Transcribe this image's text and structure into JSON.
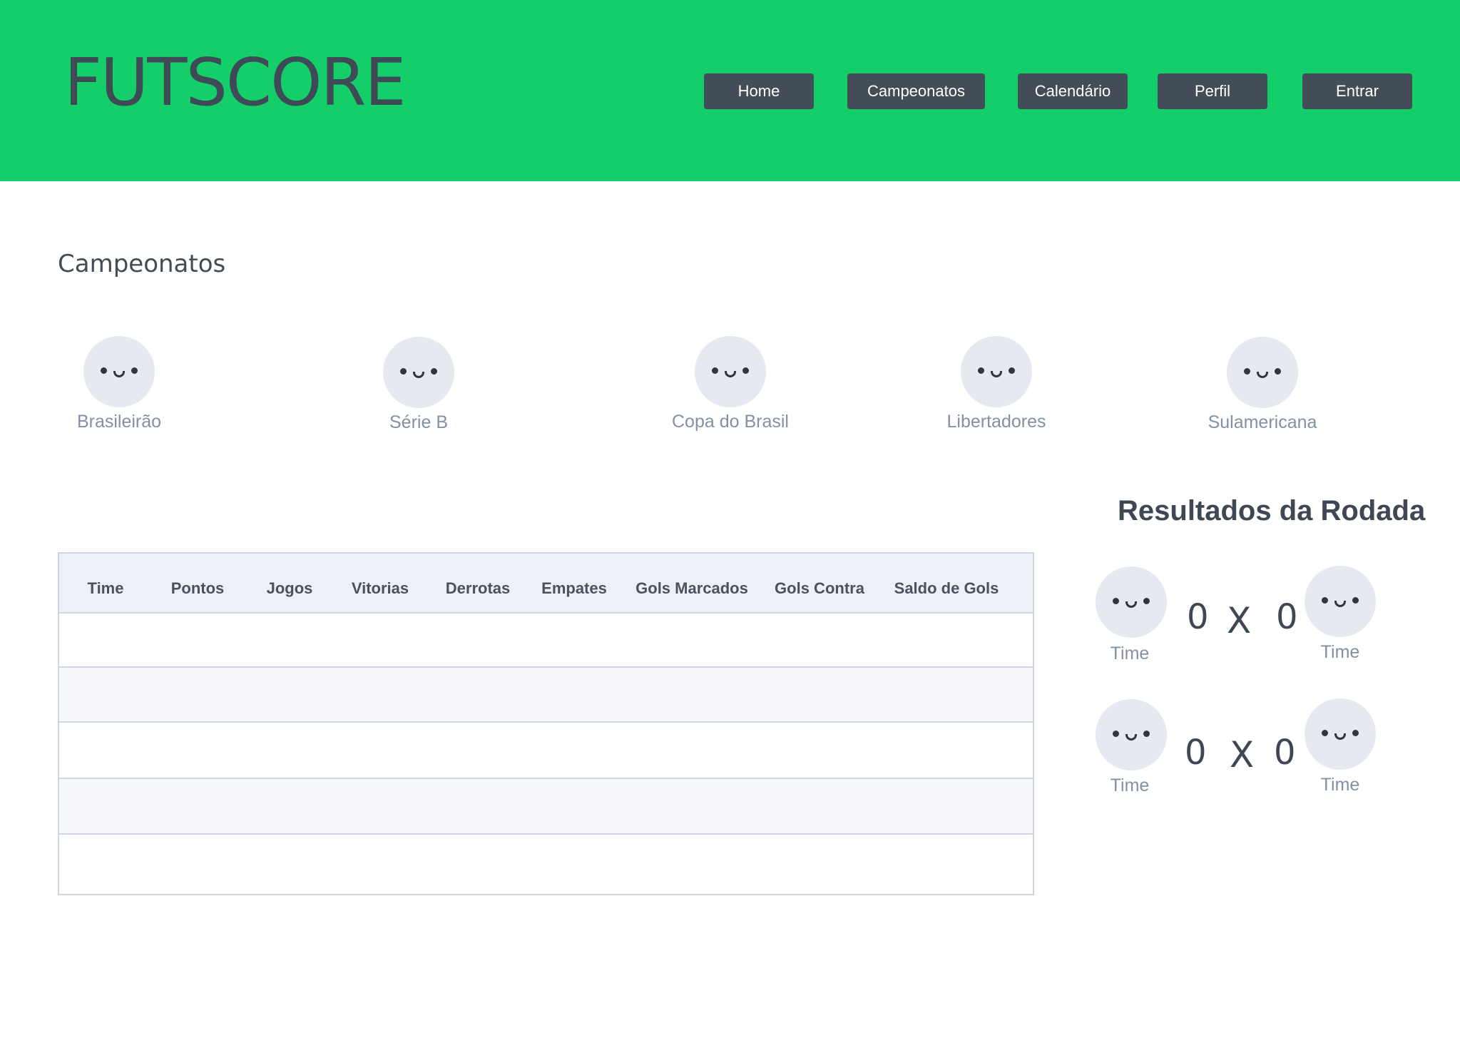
{
  "header": {
    "logo": "FUTSCORE",
    "nav": [
      "Home",
      "Campeonatos",
      "Calendário",
      "Perfil",
      "Entrar"
    ],
    "background_color": "#14cf69"
  },
  "championships": {
    "title": "Campeonatos",
    "items": [
      {
        "label": "Brasileirão",
        "icon": "face-avatar-icon"
      },
      {
        "label": "Série B",
        "icon": "face-avatar-icon"
      },
      {
        "label": "Copa do Brasil",
        "icon": "face-avatar-icon"
      },
      {
        "label": "Libertadores",
        "icon": "face-avatar-icon"
      },
      {
        "label": "Sulamericana",
        "icon": "face-avatar-icon"
      }
    ]
  },
  "standings": {
    "columns": [
      "Time",
      "Pontos",
      "Jogos",
      "Vitorias",
      "Derrotas",
      "Empates",
      "Gols Marcados",
      "Gols Contra",
      "Saldo de Gols"
    ],
    "rows": [
      [],
      [],
      [],
      [],
      []
    ]
  },
  "results": {
    "title": "Resultados da Rodada",
    "matches": [
      {
        "home": "Time",
        "away": "Time",
        "home_score": "0",
        "away_score": "0",
        "separator": "X"
      },
      {
        "home": "Time",
        "away": "Time",
        "home_score": "0",
        "away_score": "0",
        "separator": "X"
      }
    ]
  }
}
